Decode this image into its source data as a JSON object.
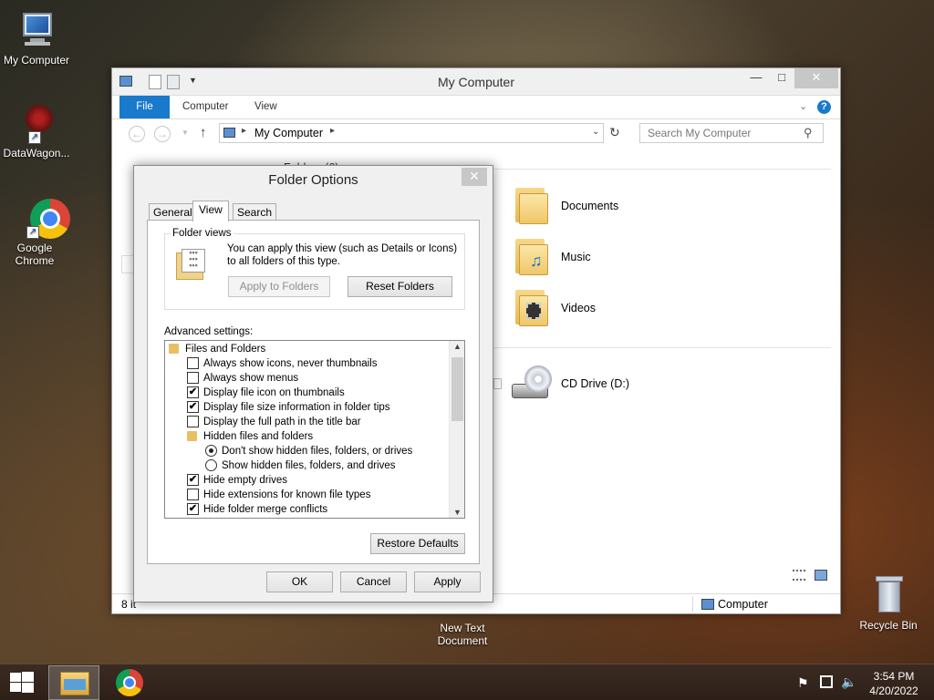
{
  "desktop": {
    "icons": [
      {
        "label": "My Computer"
      },
      {
        "label": "DataWagon..."
      },
      {
        "label": "Google Chrome"
      },
      {
        "label": "New Text Document"
      },
      {
        "label": "Recycle Bin"
      }
    ]
  },
  "explorer": {
    "title": "My Computer",
    "ribbon_tabs": [
      "File",
      "Computer",
      "View"
    ],
    "address_path": "My Computer",
    "search_placeholder": "Search My Computer",
    "partial_header": "Folders (6)",
    "folders": [
      {
        "label": "Documents",
        "icon": "documents-folder-icon"
      },
      {
        "label": "Music",
        "icon": "music-folder-icon"
      },
      {
        "label": "Videos",
        "icon": "videos-folder-icon"
      }
    ],
    "drives": [
      {
        "label": "CD Drive (D:)",
        "icon": "cd-drive-icon"
      }
    ],
    "status_left": "8 it",
    "status_right": "Computer"
  },
  "dialog": {
    "title": "Folder Options",
    "tabs": [
      "General",
      "View",
      "Search"
    ],
    "active_tab": "View",
    "folder_views": {
      "group_label": "Folder views",
      "description": "You can apply this view (such as Details or Icons) to all folders of this type.",
      "apply_button": "Apply to Folders",
      "reset_button": "Reset Folders"
    },
    "advanced_label": "Advanced settings:",
    "settings": [
      {
        "kind": "folder",
        "label": "Files and Folders",
        "indent": 0
      },
      {
        "kind": "checkbox",
        "label": "Always show icons, never thumbnails",
        "checked": false,
        "indent": 1
      },
      {
        "kind": "checkbox",
        "label": "Always show menus",
        "checked": false,
        "indent": 1
      },
      {
        "kind": "checkbox",
        "label": "Display file icon on thumbnails",
        "checked": true,
        "indent": 1
      },
      {
        "kind": "checkbox",
        "label": "Display file size information in folder tips",
        "checked": true,
        "indent": 1
      },
      {
        "kind": "checkbox",
        "label": "Display the full path in the title bar",
        "checked": false,
        "indent": 1
      },
      {
        "kind": "folder",
        "label": "Hidden files and folders",
        "indent": 1
      },
      {
        "kind": "radio",
        "label": "Don't show hidden files, folders, or drives",
        "checked": true,
        "indent": 2
      },
      {
        "kind": "radio",
        "label": "Show hidden files, folders, and drives",
        "checked": false,
        "indent": 2
      },
      {
        "kind": "checkbox",
        "label": "Hide empty drives",
        "checked": true,
        "indent": 1
      },
      {
        "kind": "checkbox",
        "label": "Hide extensions for known file types",
        "checked": false,
        "indent": 1
      },
      {
        "kind": "checkbox",
        "label": "Hide folder merge conflicts",
        "checked": true,
        "indent": 1
      }
    ],
    "restore_button": "Restore Defaults",
    "ok_button": "OK",
    "cancel_button": "Cancel",
    "apply_button": "Apply"
  },
  "taskbar": {
    "time": "3:54 PM",
    "date": "4/20/2022"
  },
  "colors": {
    "accent": "#1979ca",
    "folder": "#efc768"
  }
}
